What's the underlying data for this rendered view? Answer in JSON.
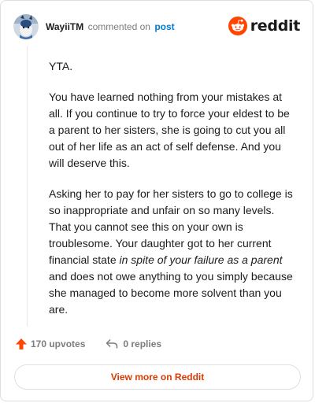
{
  "header": {
    "username": "WayiiTM",
    "action": "commented on",
    "link": "post",
    "brand": "reddit"
  },
  "comment": {
    "p1": "YTA.",
    "p2": "You have learned nothing from your mistakes at all. If you continue to try to force your eldest to be a parent to her sisters, she is going to cut you all out of her life as an act of self defense. And you will deserve this.",
    "p3_before": "Asking her to pay for her sisters to go to college is so inappropriate and unfair on so many levels. That you cannot see this on your own is troublesome. Your daughter got to her current financial state ",
    "p3_italic": "in spite of your failure as a parent",
    "p3_after": " and does not owe anything to you simply because she managed to become more solvent than you are."
  },
  "footer": {
    "upvotes": "170 upvotes",
    "replies": "0 replies"
  },
  "view_more": "View more on Reddit",
  "colors": {
    "accent": "#ff4500",
    "link": "#0079d3",
    "view_more": "#d93a00"
  },
  "icons": [
    "avatar-icon",
    "reddit-logo-icon",
    "upvote-arrow-icon",
    "reply-arrow-icon"
  ]
}
